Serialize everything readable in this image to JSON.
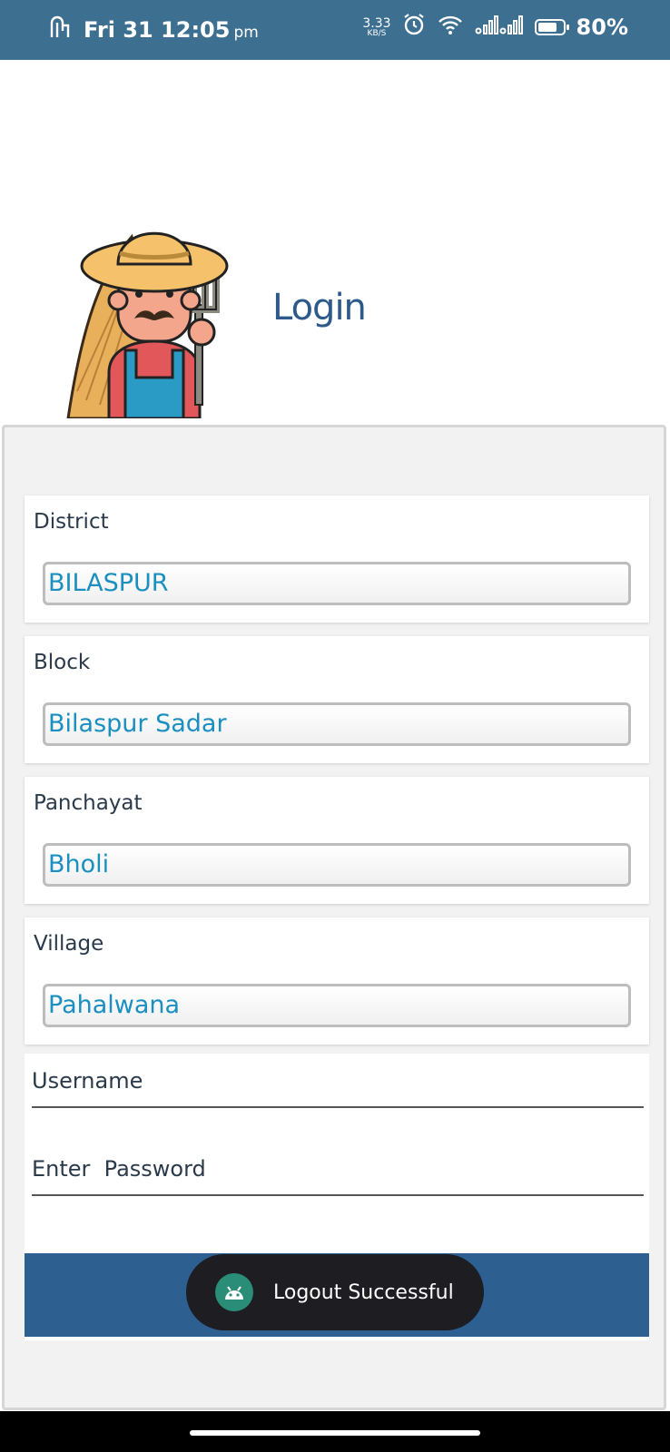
{
  "status_bar": {
    "day": "Fri",
    "date": "31",
    "time": "12:05",
    "ampm": "pm",
    "net_speed": "3.33",
    "net_speed_unit": "KB/S",
    "battery": "80%",
    "battery_level": 0.8
  },
  "header": {
    "title": "Login"
  },
  "form": {
    "district": {
      "label": "District",
      "value": "BILASPUR"
    },
    "block": {
      "label": "Block",
      "value": "Bilaspur Sadar"
    },
    "panchayat": {
      "label": "Panchayat",
      "value": "Bholi"
    },
    "village": {
      "label": "Village",
      "value": "Pahalwana"
    },
    "username": {
      "placeholder": "Username"
    },
    "password": {
      "placeholder": "Enter  Password"
    }
  },
  "toast": {
    "message": "Logout Successful"
  },
  "colors": {
    "status_bar": "#3d6f91",
    "title": "#2d5a8a",
    "spinner_value": "#1a8fc0",
    "button": "#2d5f91",
    "toast_bg": "#1d1d22"
  }
}
